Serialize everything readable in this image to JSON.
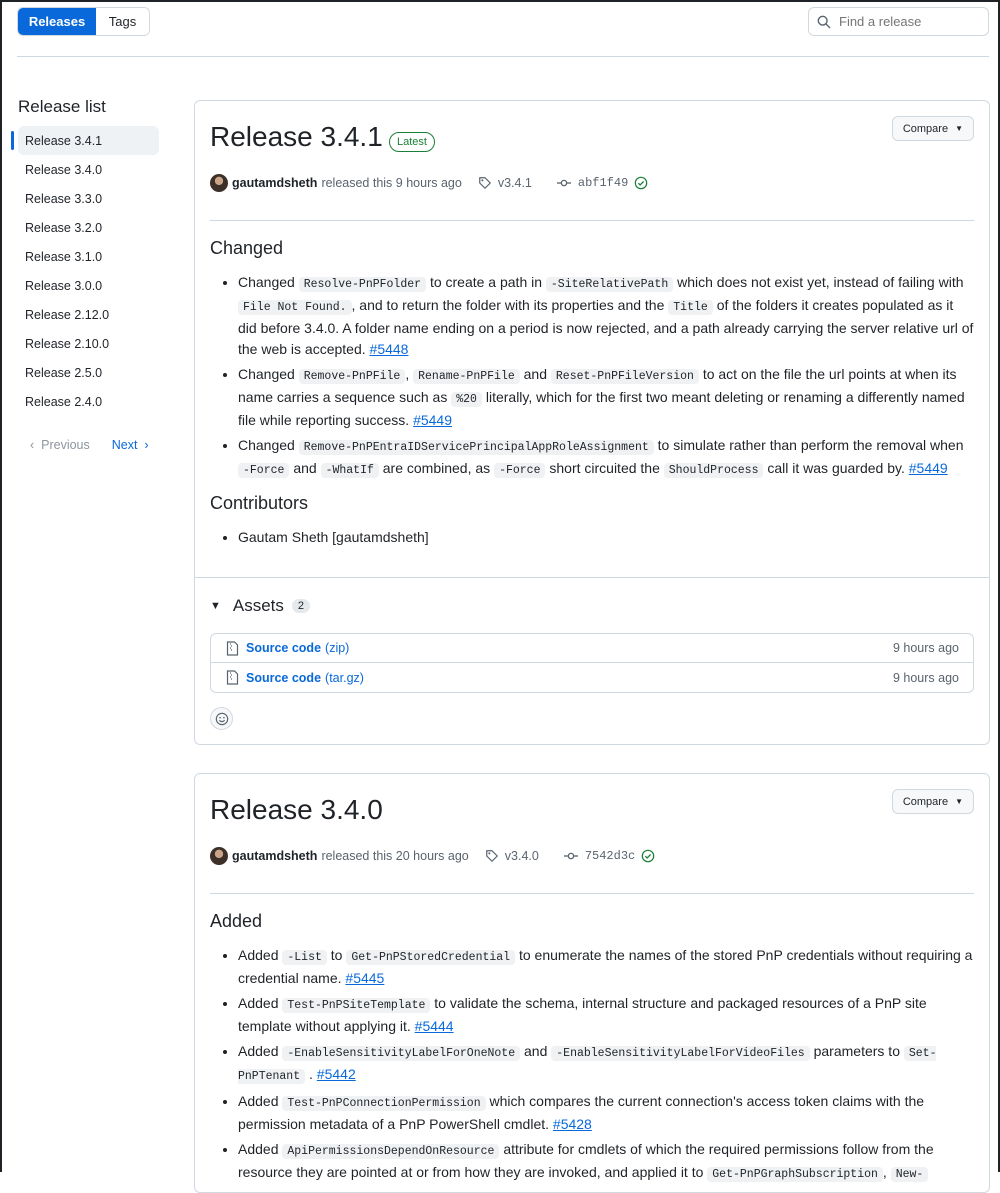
{
  "tabs": {
    "releases": "Releases",
    "tags": "Tags"
  },
  "search": {
    "placeholder": "Find a release"
  },
  "sidebar": {
    "title": "Release list",
    "items": [
      "Release 3.4.1",
      "Release 3.4.0",
      "Release 3.3.0",
      "Release 3.2.0",
      "Release 3.1.0",
      "Release 3.0.0",
      "Release 2.12.0",
      "Release 2.10.0",
      "Release 2.5.0",
      "Release 2.4.0"
    ],
    "prev": "Previous",
    "next": "Next"
  },
  "release1": {
    "title": "Release 3.4.1",
    "badge": "Latest",
    "compare": "Compare",
    "author": "gautamdsheth",
    "released": "released this 9 hours ago",
    "tag": "v3.4.1",
    "commit": "abf1f49",
    "changed_heading": "Changed",
    "contributors_heading": "Contributors",
    "contributor": "Gautam Sheth [gautamdsheth]",
    "assets_heading": "Assets",
    "assets_count": "2",
    "assets": [
      {
        "name": "Source code",
        "ext": "(zip)",
        "time": "9 hours ago"
      },
      {
        "name": "Source code",
        "ext": "(tar.gz)",
        "time": "9 hours ago"
      }
    ],
    "notes": {
      "n1": {
        "w1": "Changed",
        "c1": "Resolve-PnPFolder",
        "t1": "to create a path in",
        "c2": "-SiteRelativePath",
        "t2": "which does not exist yet, instead of failing with",
        "c3": "File Not Found.",
        "t3": ", and to return the folder with its properties and the",
        "c4": "Title",
        "t4": "of the folders it creates populated as it did before 3.4.0. A folder name ending on a period is now rejected, and a path already carrying the server relative url of the web is accepted.",
        "pr": "#5448"
      },
      "n2": {
        "w1": "Changed",
        "c1": "Remove-PnPFile",
        "t1": ",",
        "c2": "Rename-PnPFile",
        "t2": "and",
        "c3": "Reset-PnPFileVersion",
        "t3": "to act on the file the url points at when its name carries a sequence such as",
        "c4": "%20",
        "t4": "literally, which for the first two meant deleting or renaming a differently named file while reporting success.",
        "pr": "#5449"
      },
      "n3": {
        "w1": "Changed",
        "c1": "Remove-PnPEntraIDServicePrincipalAppRoleAssignment",
        "t1": "to simulate rather than perform the removal when",
        "c2": "-Force",
        "t2": "and",
        "c3": "-WhatIf",
        "t3": "are combined, as",
        "c4": "-Force",
        "t4": "short circuited the",
        "c5": "ShouldProcess",
        "t5": "call it was guarded by.",
        "pr": "#5449"
      }
    }
  },
  "release2": {
    "title": "Release 3.4.0",
    "compare": "Compare",
    "author": "gautamdsheth",
    "released": "released this 20 hours ago",
    "tag": "v3.4.0",
    "commit": "7542d3c",
    "added_heading": "Added",
    "notes": {
      "n1": {
        "w1": "Added",
        "c1": "-List",
        "t1": "to",
        "c2": "Get-PnPStoredCredential",
        "t2": "to enumerate the names of the stored PnP credentials without requiring a credential name.",
        "pr": "#5445"
      },
      "n2": {
        "w1": "Added",
        "c1": "Test-PnPSiteTemplate",
        "t1": "to validate the schema, internal structure and packaged resources of a PnP site template without applying it.",
        "pr": "#5444"
      },
      "n3": {
        "w1": "Added",
        "c1": "-EnableSensitivityLabelForOneNote",
        "t1": "and",
        "c2": "-EnableSensitivityLabelForVideoFiles",
        "t2": "parameters to",
        "c3": "Set-PnPTenant",
        "t3": ".",
        "pr": "#5442"
      },
      "n4": {
        "w1": "Added",
        "c1": "Test-PnPConnectionPermission",
        "t1": "which compares the current connection's access token claims with the permission metadata of a PnP PowerShell cmdlet.",
        "pr": "#5428"
      },
      "n5": {
        "w1": "Added",
        "c1": "ApiPermissionsDependOnResource",
        "t1": "attribute for cmdlets of which the required permissions follow from the resource they are pointed at or from how they are invoked, and applied it to",
        "c2": "Get-PnPGraphSubscription",
        "t2": ",",
        "c3": "New-"
      }
    }
  }
}
